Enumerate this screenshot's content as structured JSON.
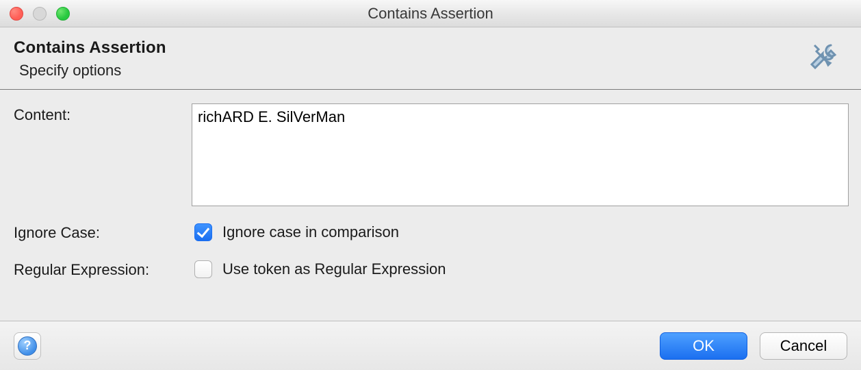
{
  "window": {
    "title": "Contains Assertion"
  },
  "header": {
    "title": "Contains Assertion",
    "subtitle": "Specify options",
    "icon": "settings-tools-icon"
  },
  "form": {
    "content": {
      "label": "Content:",
      "value": "richARD E. SilVerMan"
    },
    "ignoreCase": {
      "label": "Ignore Case:",
      "checkboxLabel": "Ignore case in comparison",
      "checked": true
    },
    "regex": {
      "label": "Regular Expression:",
      "checkboxLabel": "Use token as Regular Expression",
      "checked": false
    }
  },
  "footer": {
    "help": "help-icon",
    "ok": "OK",
    "cancel": "Cancel"
  }
}
